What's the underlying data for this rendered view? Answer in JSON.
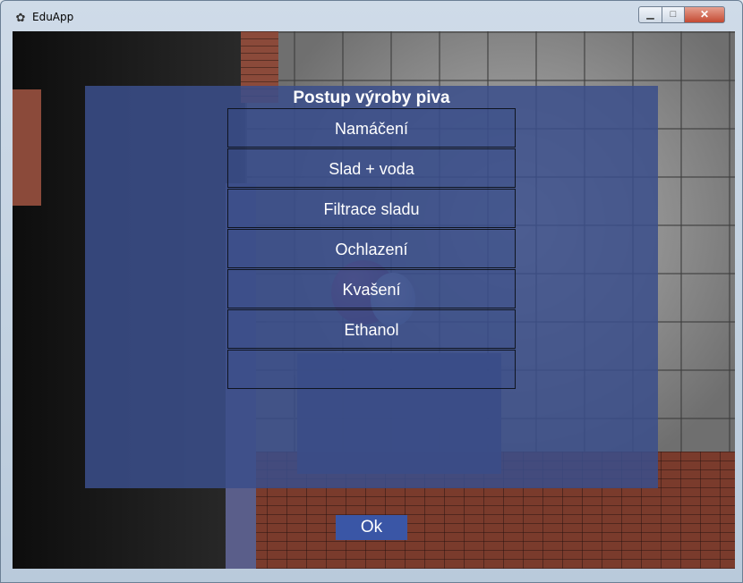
{
  "window": {
    "title": "EduApp",
    "icons": {
      "app": "app-icon",
      "minimize": "minimize-icon",
      "maximize": "maximize-icon",
      "close": "close-icon"
    }
  },
  "dialog": {
    "title": "Postup výroby piva",
    "steps": [
      {
        "label": "Namáčení"
      },
      {
        "label": "Slad + voda"
      },
      {
        "label": "Filtrace sladu"
      },
      {
        "label": "Ochlazení"
      },
      {
        "label": "Kvašení"
      },
      {
        "label": "Ethanol"
      },
      {
        "label": ""
      }
    ],
    "ok_label": "Ok"
  },
  "colors": {
    "dialog_bg": "#3a4e8a",
    "button_bg": "#3a56a6"
  }
}
